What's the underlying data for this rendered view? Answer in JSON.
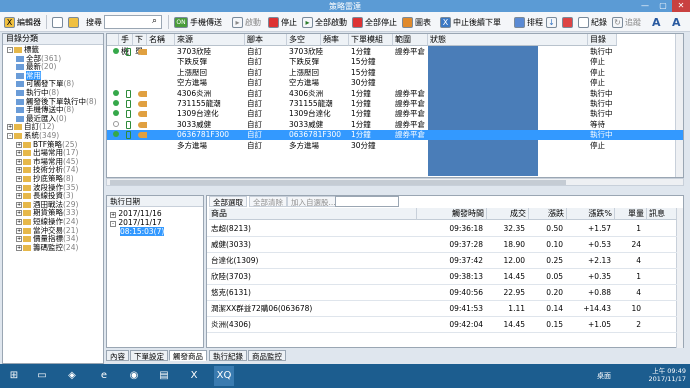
{
  "window": {
    "title": "策略雷達",
    "min": "—",
    "max": "▢",
    "close": "✕"
  },
  "toolbar": {
    "edit": "編輯器",
    "search_label": "搜尋",
    "manual": "手機傳送",
    "start": "啟動",
    "stop": "停止",
    "start_all": "全部啟動",
    "stop_all": "全部停止",
    "chart": "圖表",
    "halt": "中止後續下單",
    "rank": "排程",
    "record": "紀錄",
    "history": "追蹤",
    "font_up": "A",
    "font_down": "A"
  },
  "left_panel": {
    "header": "目錄分類",
    "tree": [
      {
        "label": "標籤",
        "count": "",
        "level": 0,
        "box": "-"
      },
      {
        "label": "全部",
        "count": "(361)",
        "level": 1
      },
      {
        "label": "最新",
        "count": "(20)",
        "level": 1
      },
      {
        "label": "常用",
        "count": "",
        "level": 1,
        "selected": true
      },
      {
        "label": "可觸發下單",
        "count": "(8)",
        "level": 1
      },
      {
        "label": "執行中",
        "count": "(8)",
        "level": 1
      },
      {
        "label": "觸發後下單執行中",
        "count": "(8)",
        "level": 1
      },
      {
        "label": "手機傳送中",
        "count": "(8)",
        "level": 1
      },
      {
        "label": "最近匯入",
        "count": "(0)",
        "level": 1
      },
      {
        "label": "自訂",
        "count": "(12)",
        "level": 0,
        "box": "+"
      },
      {
        "label": "系統",
        "count": "(349)",
        "level": 0,
        "box": "-"
      },
      {
        "label": "BTF策略",
        "count": "(25)",
        "level": 1,
        "box": "+"
      },
      {
        "label": "出場常用",
        "count": "(17)",
        "level": 1,
        "box": "+"
      },
      {
        "label": "市場常用",
        "count": "(45)",
        "level": 1,
        "box": "+"
      },
      {
        "label": "技術分析",
        "count": "(74)",
        "level": 1,
        "box": "+"
      },
      {
        "label": "抄底策略",
        "count": "(8)",
        "level": 1,
        "box": "+"
      },
      {
        "label": "波段操作",
        "count": "(35)",
        "level": 1,
        "box": "+"
      },
      {
        "label": "長線投資",
        "count": "(3)",
        "level": 1,
        "box": "+"
      },
      {
        "label": "酒田戰法",
        "count": "(29)",
        "level": 1,
        "box": "+"
      },
      {
        "label": "期貨策略",
        "count": "(33)",
        "level": 1,
        "box": "+"
      },
      {
        "label": "短線操作",
        "count": "(24)",
        "level": 1,
        "box": "+"
      },
      {
        "label": "當沖交易",
        "count": "(21)",
        "level": 1,
        "box": "+"
      },
      {
        "label": "價量指標",
        "count": "(34)",
        "level": 1,
        "box": "+"
      },
      {
        "label": "籌碼監控",
        "count": "(24)",
        "level": 1,
        "box": "+"
      }
    ]
  },
  "grid": {
    "headers": [
      "",
      "手機",
      "下單",
      "名稱",
      "來源",
      "腳本",
      "多空",
      "頻率",
      "下單模組",
      "範圍",
      "狀態",
      "目錄"
    ],
    "rows": [
      {
        "dot": true,
        "phone": true,
        "order": true,
        "name": "3703欣陸",
        "source": "自訂",
        "script": "3703欣陸",
        "freq": "1分鐘",
        "module": "證券平倉",
        "status": "執行中"
      },
      {
        "dot": false,
        "phone": false,
        "order": false,
        "name": "下跌反彈",
        "source": "自訂",
        "script": "下跌反彈",
        "freq": "15分鐘",
        "module": "",
        "status": "停止"
      },
      {
        "dot": false,
        "phone": false,
        "order": false,
        "name": "上漲壓回",
        "source": "自訂",
        "script": "上漲壓回",
        "freq": "15分鐘",
        "module": "",
        "status": "停止"
      },
      {
        "dot": false,
        "phone": false,
        "order": false,
        "name": "空方進場",
        "source": "自訂",
        "script": "空方進場",
        "freq": "30分鐘",
        "module": "",
        "status": "停止"
      },
      {
        "dot": true,
        "phone": true,
        "order": true,
        "name": "4306炎洲",
        "source": "自訂",
        "script": "4306炎洲",
        "freq": "1分鐘",
        "module": "證券平倉",
        "status": "執行中"
      },
      {
        "dot": true,
        "phone": true,
        "order": true,
        "name": "731155龍潮",
        "source": "自訂",
        "script": "731155龍潮",
        "freq": "1分鐘",
        "module": "證券平倉",
        "status": "執行中"
      },
      {
        "dot": true,
        "phone": true,
        "order": true,
        "name": "1309台達化",
        "source": "自訂",
        "script": "1309台達化",
        "freq": "1分鐘",
        "module": "證券平倉",
        "status": "執行中"
      },
      {
        "dot": false,
        "phone": true,
        "order": true,
        "name": "3033威健",
        "source": "自訂",
        "script": "3033威健",
        "freq": "1分鐘",
        "module": "證券平倉",
        "status": "等待"
      },
      {
        "dot": true,
        "phone": true,
        "order": true,
        "name": "0636781F300",
        "source": "自訂",
        "script": "0636781F300",
        "freq": "1分鐘",
        "module": "證券平倉",
        "status": "執行中",
        "selected": true
      },
      {
        "dot": false,
        "phone": false,
        "order": false,
        "name": "多方進場",
        "source": "自訂",
        "script": "多方進場",
        "freq": "30分鐘",
        "module": "",
        "status": "停止"
      }
    ]
  },
  "exec_panel": {
    "header": "執行日期",
    "items": [
      "2017/11/16",
      "2017/11/17",
      "08:15:03(7)"
    ]
  },
  "result_panel": {
    "buttons": [
      "全部選取",
      "全部清除",
      "加入自選股..."
    ],
    "headers": [
      "商品",
      "觸發時間",
      "成交",
      "漲跌",
      "漲跌%",
      "單量",
      "訊息"
    ],
    "rows": [
      {
        "name": "志超(8213)",
        "time": "09:36:18",
        "price": "32.35",
        "chg": "0.50",
        "pct": "+1.57",
        "vol": "1"
      },
      {
        "name": "威健(3033)",
        "time": "09:37:28",
        "price": "18.90",
        "chg": "0.10",
        "pct": "+0.53",
        "vol": "24"
      },
      {
        "name": "台達化(1309)",
        "time": "09:37:42",
        "price": "12.00",
        "chg": "0.25",
        "pct": "+2.13",
        "vol": "4"
      },
      {
        "name": "欣陸(3703)",
        "time": "09:38:13",
        "price": "14.45",
        "chg": "0.05",
        "pct": "+0.35",
        "vol": "1"
      },
      {
        "name": "悠克(6131)",
        "time": "09:40:56",
        "price": "22.95",
        "chg": "0.20",
        "pct": "+0.88",
        "vol": "4"
      },
      {
        "name": "潤潔XX群益72購06(063678)",
        "time": "09:41:53",
        "price": "1.11",
        "chg": "0.14",
        "pct": "+14.43",
        "vol": "10"
      },
      {
        "name": "炎洲(4306)",
        "time": "09:42:04",
        "price": "14.45",
        "chg": "0.15",
        "pct": "+1.05",
        "vol": "2"
      }
    ]
  },
  "tabs": {
    "left": [
      "內容",
      "下單設定",
      "觸發商品"
    ],
    "right": [
      "執行紀錄",
      "商品監控"
    ]
  },
  "taskbar": {
    "tray_label": "桌面",
    "time": "上午 09:49",
    "date": "2017/11/17"
  }
}
